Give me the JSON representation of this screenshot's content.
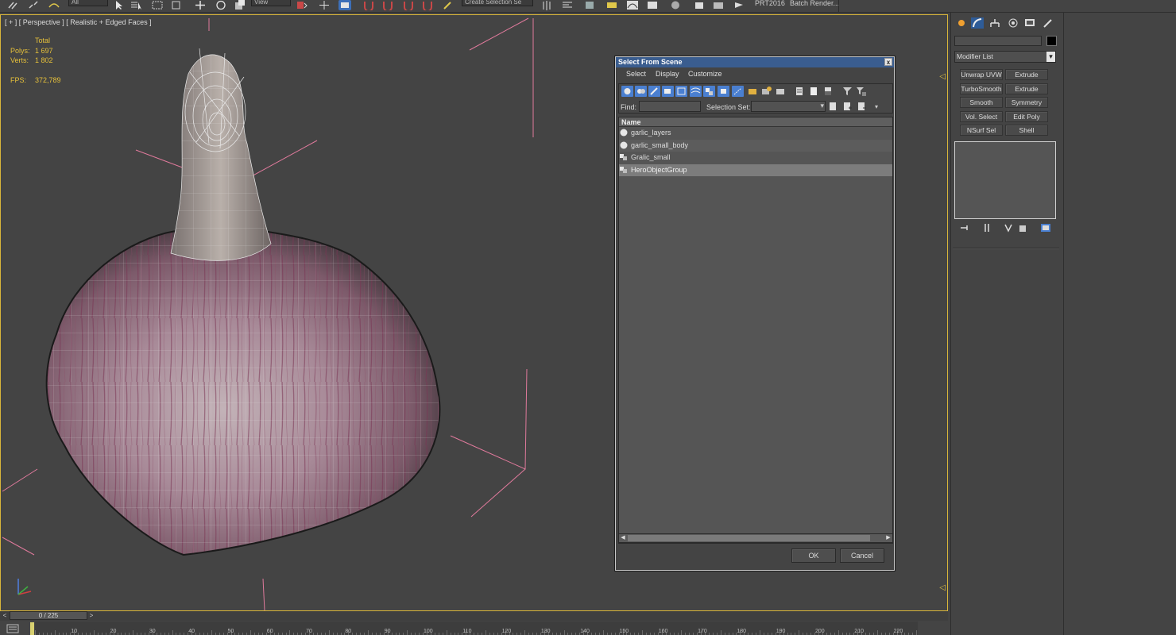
{
  "toolbar": {
    "filter_dropdown": "All",
    "coord_dropdown": "View",
    "selection_set_dropdown": "Create Selection Se",
    "items": [
      "PRT2016",
      "Batch Render..."
    ]
  },
  "viewport": {
    "label": "[ + ] [ Perspective ] [ Realistic + Edged Faces ]",
    "stats": {
      "header": "Total",
      "polys_label": "Polys:",
      "polys_value": "1 697",
      "verts_label": "Verts:",
      "verts_value": "1 802",
      "fps_label": "FPS:",
      "fps_value": "372,789"
    }
  },
  "dialog": {
    "title": "Select From Scene",
    "close": "x",
    "menu": [
      "Select",
      "Display",
      "Customize"
    ],
    "find_label": "Find:",
    "find_value": "",
    "selection_set_label": "Selection Set:",
    "column_header": "Name",
    "rows": [
      {
        "name": "garlic_layers",
        "icon": "geometry-sphere-icon"
      },
      {
        "name": "garlic_small_body",
        "icon": "geometry-sphere-icon"
      },
      {
        "name": "Gralic_small",
        "icon": "group-icon"
      },
      {
        "name": "HeroObjectGroup",
        "icon": "group-icon",
        "selected": true
      }
    ],
    "ok": "OK",
    "cancel": "Cancel"
  },
  "command_panel": {
    "modifier_list": "Modifier List",
    "buttons": [
      [
        "Unwrap UVW",
        "Extrude"
      ],
      [
        "TurboSmooth",
        "Extrude"
      ],
      [
        "Smooth",
        "Symmetry"
      ],
      [
        "Vol. Select",
        "Edit Poly"
      ],
      [
        "NSurf Sel",
        "Shell"
      ]
    ],
    "object_color": "#000000"
  },
  "timeline": {
    "frame": "0 / 225",
    "ticks": [
      "10",
      "20",
      "30",
      "40",
      "50",
      "60",
      "70",
      "80",
      "90",
      "100",
      "110",
      "120",
      "130",
      "140",
      "150",
      "160",
      "170",
      "180",
      "190",
      "200",
      "210",
      "220"
    ]
  },
  "colors": {
    "viewport_border": "#d8b53a",
    "stats_text": "#e6c03a",
    "dialog_title_bg": "#3a5d8f",
    "selection_row": "#7c7c7c",
    "bounding_box": "#e07a9c"
  }
}
